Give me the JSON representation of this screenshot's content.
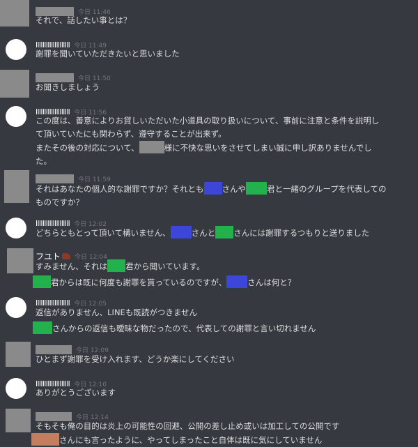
{
  "messages": [
    {
      "author": "",
      "time": "今日 11:46",
      "lines": [
        "それで、話したい事とは？"
      ]
    },
    {
      "author": "llllllllllllllllllll",
      "time": "今日 11:49",
      "lines": [
        "謝罪を聞いていただきたいと思いました"
      ]
    },
    {
      "author": "",
      "time": "今日 11:50",
      "lines": [
        "お聞きしましょう"
      ]
    },
    {
      "author": "llllllllllllllllllll",
      "time": "今日 11:56",
      "lines": [
        "この度は、善意によりお貸しいただいた小道具の取り扱いについて、事前に注意と条件を説明し",
        "て頂いていたにも関わらず、遵守することが出来ず。",
        {
          "a": "またその後の対応について、",
          "b": "様に不快な思いをさせてしまい誠に申し訳ありませんでし"
        },
        "た。"
      ]
    },
    {
      "author": "",
      "time": "今日 11:59",
      "lines": [
        {
          "a": "それはあなたの個人的な謝罪ですか？それとも",
          "b": "さんや",
          "c": "君と一緒のグループを代表しての"
        },
        "ものですか？"
      ]
    },
    {
      "author": "llllllllllllllllllll",
      "time": "今日 12:02",
      "lines": [
        {
          "a": "どちらともとって頂いて構いません、",
          "b": "さんと",
          "c": "さんには謝罪するつもりと送りました"
        }
      ]
    },
    {
      "author": "フユト",
      "time": "今日 12:04",
      "lines": [
        {
          "a": "すみません、それは",
          "b": "君から聞いています。"
        },
        {
          "a": "君からは既に何度も謝罪を貰っているのですが、",
          "b": "さんは何と？"
        }
      ]
    },
    {
      "author": "llllllllllllllllllll",
      "time": "今日 12:05",
      "lines": [
        "返信がありません、LINEも既読がつきません",
        {
          "a": "さんからの返信も曖昧な物だったので、代表しての謝罪と言い切れません"
        }
      ]
    },
    {
      "author": "",
      "time": "今日 12:09",
      "lines": [
        "ひとまず謝罪を受け入れます、どうか楽にしてください"
      ]
    },
    {
      "author": "llllllllllllllllllll",
      "time": "今日 12:10",
      "lines": [
        "ありがとうございます"
      ]
    },
    {
      "author": "",
      "time": "今日 12:14",
      "lines": [
        "そもそも俺の目的は炎上の可能性の回避、公開の差し止め或いは加工しての公開です",
        {
          "a": "さんにも言ったように、やってしまったこと自体は既に気にしていません"
        }
      ]
    }
  ],
  "colors": {
    "background": "#36393f",
    "text": "#dcddde",
    "timestamp": "#72767d",
    "redact_gray": "#8a8a8a",
    "redact_blue": "#3c46d8",
    "redact_green": "#22b14c",
    "redact_orange": "#c47e5e"
  }
}
